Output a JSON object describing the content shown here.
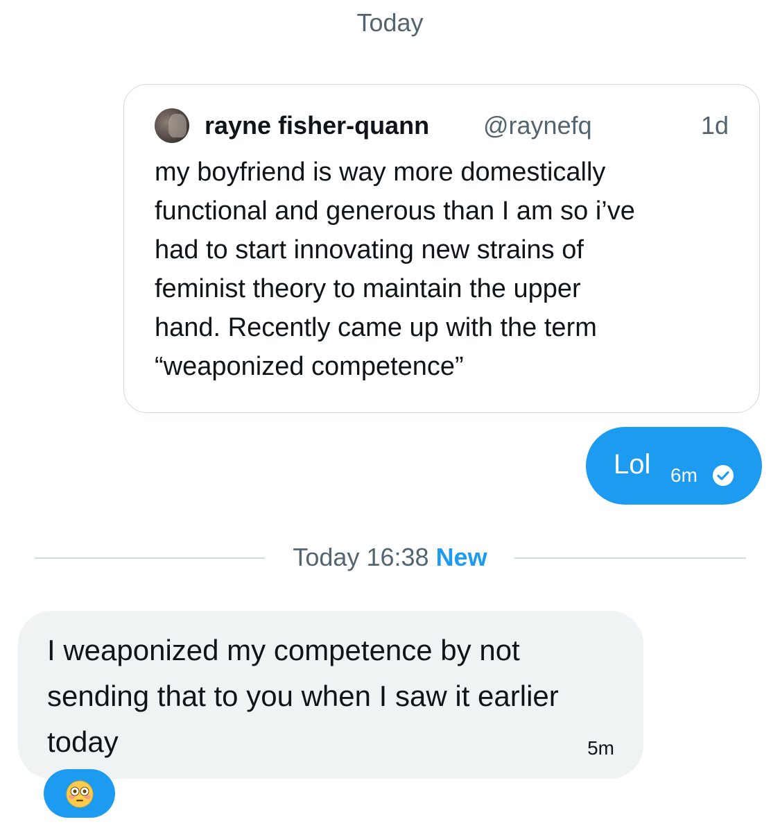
{
  "conversation": {
    "date_header": "Today"
  },
  "quoted_tweet": {
    "author_name": "rayne fisher-quann",
    "author_handle": "@raynefq",
    "age": "1d",
    "text_lines": [
      "my boyfriend is way more domestically",
      "functional and generous than I am so i’ve",
      "had to start innovating new strains of",
      "feminist theory to maintain the upper",
      "hand. Recently came up with the term",
      "“weaponized competence”"
    ]
  },
  "sent_message": {
    "text": "Lol",
    "time": "6m",
    "status_icon": "seen-check-icon"
  },
  "new_divider": {
    "timestamp": "Today 16:38",
    "new_label": "New"
  },
  "received_message": {
    "text_lines": [
      "I weaponized my competence by not",
      "sending that to you when I saw it earlier",
      "today"
    ],
    "time": "5m",
    "reaction": "flushed-face-emoji"
  },
  "colors": {
    "accent": "#1d9bf0",
    "received_bubble": "#eff3f4",
    "secondary_text": "#536471",
    "border": "#cfd9de"
  }
}
